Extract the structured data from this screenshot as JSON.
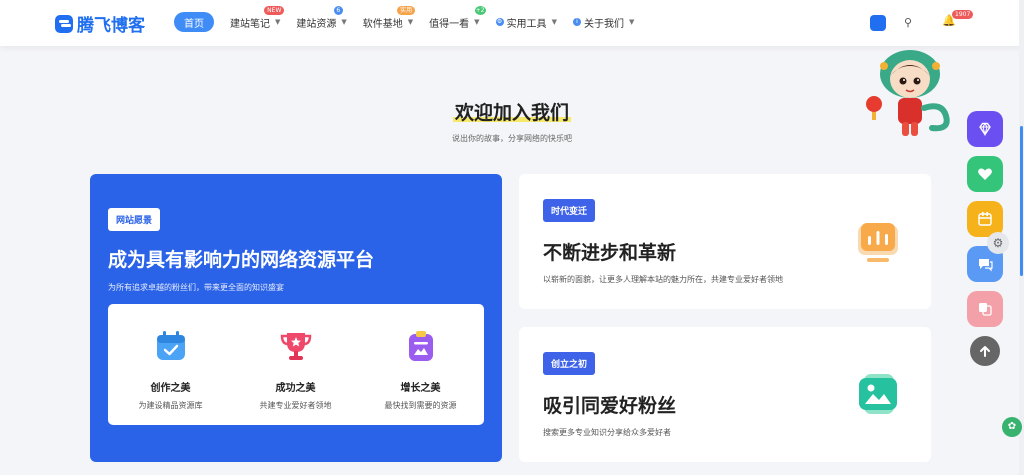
{
  "header": {
    "logo_text": "腾飞博客",
    "nav": [
      {
        "label": "首页",
        "badge": ""
      },
      {
        "label": "建站笔记",
        "badge": "NEW"
      },
      {
        "label": "建站资源",
        "badge": "6"
      },
      {
        "label": "软件基地",
        "badge": "实用"
      },
      {
        "label": "值得一看",
        "badge": "+2"
      },
      {
        "label": "实用工具",
        "badge": ""
      },
      {
        "label": "关于我们",
        "badge": ""
      }
    ],
    "notification_count": "1907"
  },
  "section": {
    "title": "欢迎加入我们",
    "subtitle": "说出你的故事，分享网络的快乐吧"
  },
  "vision_card": {
    "tag": "网站愿景",
    "title": "成为具有影响力的网络资源平台",
    "subtitle": "为所有追求卓越的粉丝们，带来更全面的知识盛宴",
    "features": [
      {
        "title": "创作之美",
        "desc": "为建设精品资源库"
      },
      {
        "title": "成功之美",
        "desc": "共建专业爱好者领地"
      },
      {
        "title": "增长之美",
        "desc": "最快找到需要的资源"
      }
    ]
  },
  "cards": [
    {
      "tag": "时代变迁",
      "title": "不断进步和革新",
      "desc": "以崭新的面貌，让更多人理解本站的魅力所在，共建专业爱好者领地"
    },
    {
      "tag": "创立之初",
      "title": "吸引同爱好粉丝",
      "desc": "搜索更多专业知识分享给众多爱好者"
    }
  ],
  "colors": {
    "primary": "#2b63e8",
    "accent": "#3f8cf6"
  },
  "icons": {
    "floating": [
      "diamond-icon",
      "heart-icon",
      "calendar-icon",
      "chat-icon",
      "translate-icon",
      "arrow-up-icon"
    ]
  }
}
